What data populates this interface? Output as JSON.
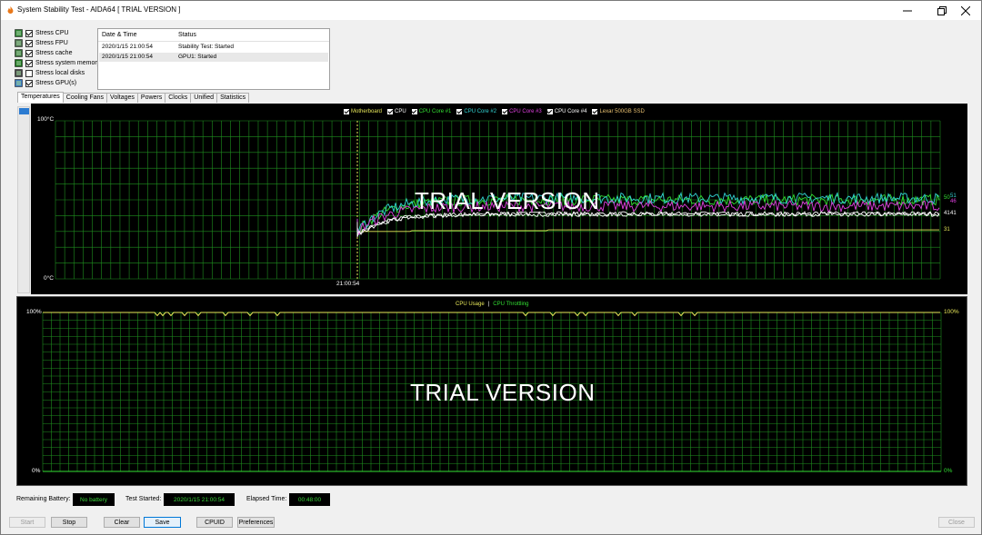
{
  "window": {
    "title": "System Stability Test - AIDA64  [ TRIAL VERSION ]"
  },
  "stress_options": [
    {
      "label": "Stress CPU",
      "checked": true,
      "icon": "cpu-icon"
    },
    {
      "label": "Stress FPU",
      "checked": true,
      "icon": "fpu-icon"
    },
    {
      "label": "Stress cache",
      "checked": true,
      "icon": "cache-icon"
    },
    {
      "label": "Stress system memory",
      "checked": true,
      "icon": "memory-icon"
    },
    {
      "label": "Stress local disks",
      "checked": false,
      "icon": "disk-icon"
    },
    {
      "label": "Stress GPU(s)",
      "checked": true,
      "icon": "gpu-icon"
    }
  ],
  "log": {
    "headers": [
      "Date & Time",
      "Status"
    ],
    "rows": [
      {
        "time": "2020/1/15 21:00:54",
        "status": "Stability Test: Started"
      },
      {
        "time": "2020/1/15 21:00:54",
        "status": "GPU1: Started"
      }
    ]
  },
  "tabs": [
    "Temperatures",
    "Cooling Fans",
    "Voltages",
    "Powers",
    "Clocks",
    "Unified",
    "Statistics"
  ],
  "active_tab": "Temperatures",
  "temp_chart": {
    "legend": [
      {
        "label": "Motherboard",
        "color": "#e8e85a"
      },
      {
        "label": "CPU",
        "color": "#ffffff"
      },
      {
        "label": "CPU Core #1",
        "color": "#33e033"
      },
      {
        "label": "CPU Core #2",
        "color": "#33d6d6"
      },
      {
        "label": "CPU Core #3",
        "color": "#e040e0"
      },
      {
        "label": "CPU Core #4",
        "color": "#ffffff"
      },
      {
        "label": "Lexar 500GB SSD",
        "color": "#e8c070"
      }
    ],
    "y_max_label": "100°C",
    "y_min_label": "0°C",
    "start_time_label": "21:00:54",
    "watermark": "TRIAL VERSION",
    "end_labels": [
      {
        "text": "50",
        "color": "#33e033"
      },
      {
        "text": "51",
        "color": "#33d6d6"
      },
      {
        "text": "46",
        "color": "#e040e0"
      },
      {
        "text": "41",
        "color": "#ffffff"
      },
      {
        "text": "41",
        "color": "#ffffff"
      },
      {
        "text": "31",
        "color": "#e8e85a"
      }
    ]
  },
  "chart_data": [
    {
      "type": "line",
      "title": "",
      "ylabel": "",
      "ylim": [
        0,
        100
      ],
      "x_start_label": "21:00:54",
      "series": [
        {
          "name": "Motherboard",
          "start": 24,
          "steady": 31
        },
        {
          "name": "CPU",
          "start": 28,
          "steady": 41
        },
        {
          "name": "CPU Core #1",
          "start": 30,
          "steady": 50
        },
        {
          "name": "CPU Core #2",
          "start": 30,
          "steady": 51
        },
        {
          "name": "CPU Core #3",
          "start": 30,
          "steady": 46
        },
        {
          "name": "CPU Core #4",
          "start": 28,
          "steady": 41
        }
      ]
    },
    {
      "type": "line",
      "title": "",
      "ylim": [
        0,
        100
      ],
      "series": [
        {
          "name": "CPU Usage",
          "steady": 100
        },
        {
          "name": "CPU Throttling",
          "steady": 0
        }
      ]
    }
  ],
  "cpu_chart": {
    "legend_usage": "CPU Usage",
    "legend_sep": "|",
    "legend_throttling": "CPU Throttling",
    "usage_color": "#e8e85a",
    "throttle_color": "#33e033",
    "y_max_label": "100%",
    "y_min_label": "0%",
    "right_max_label": "100%",
    "right_min_label": "0%",
    "watermark": "TRIAL VERSION"
  },
  "status": {
    "battery_label": "Remaining Battery:",
    "battery_value": "No battery",
    "started_label": "Test Started:",
    "started_value": "2020/1/15 21:00:54",
    "elapsed_label": "Elapsed Time:",
    "elapsed_value": "00:48:00"
  },
  "buttons": {
    "start": "Start",
    "stop": "Stop",
    "clear": "Clear",
    "save": "Save",
    "cpuid": "CPUID",
    "preferences": "Preferences",
    "close": "Close"
  },
  "colors": {
    "grid": "#1f8f1f",
    "chart_bg": "#000000"
  }
}
